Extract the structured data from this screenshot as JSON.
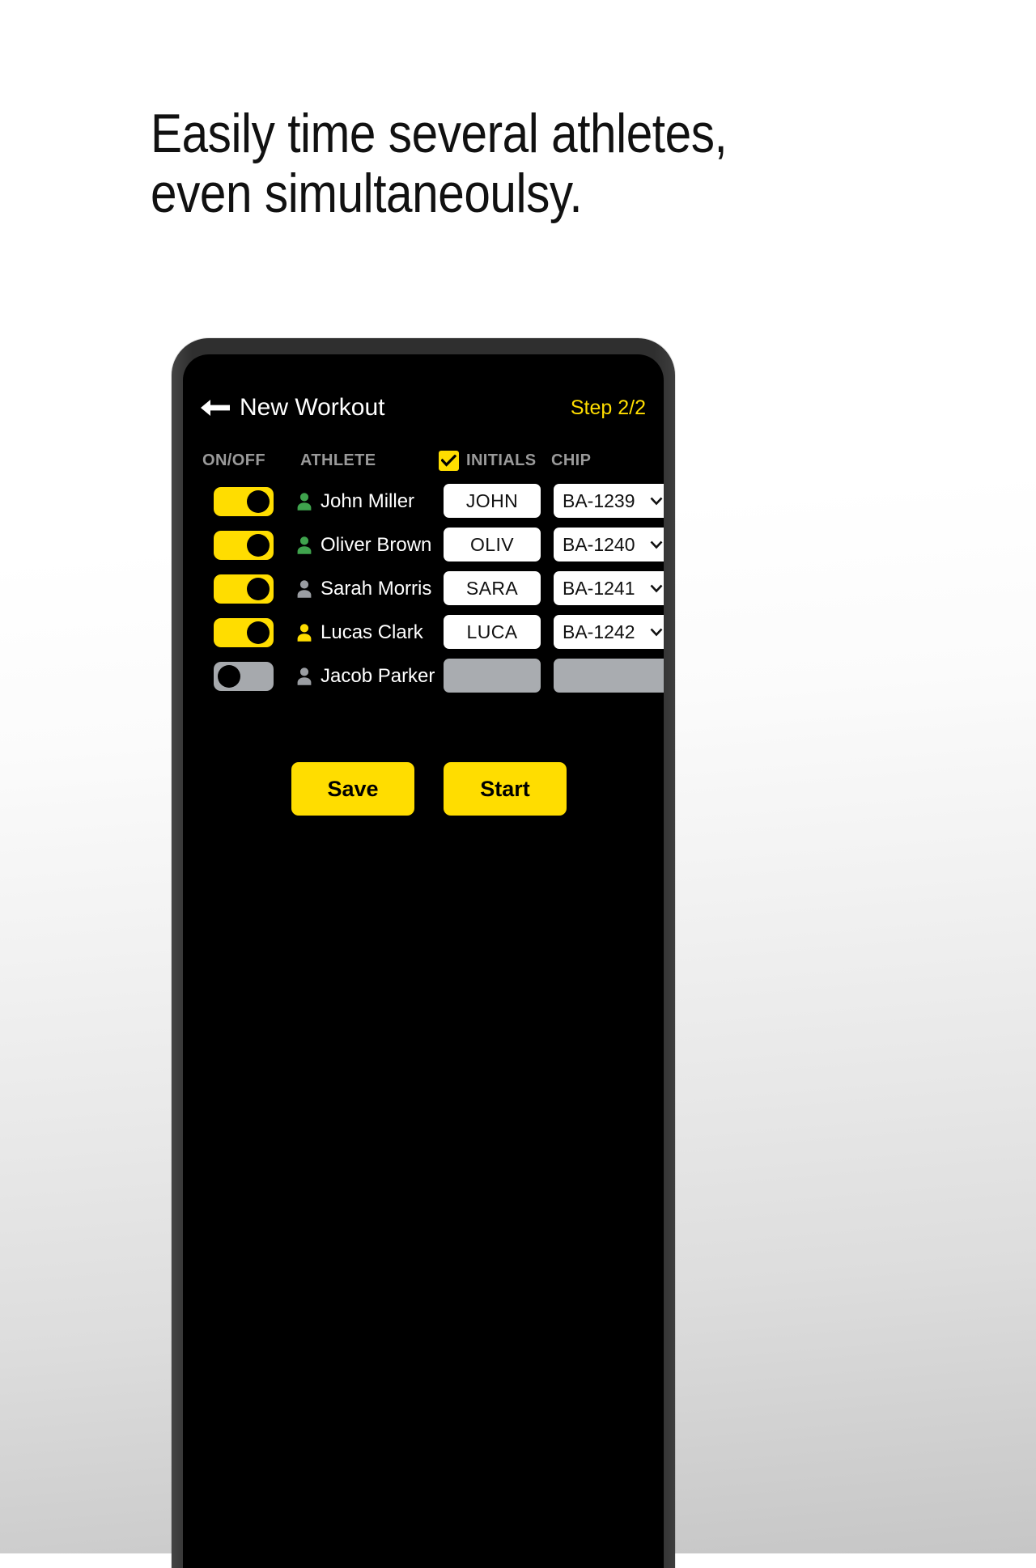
{
  "headline": {
    "line1": "Easily time several athletes,",
    "line2": "even simultaneoulsy."
  },
  "colors": {
    "accent": "#FFDD00",
    "screen_bg": "#000000",
    "phone_bezel": "#2F2F2F",
    "header_label": "#9A9A9A",
    "disabled": "#A9ACB0",
    "icon_green": "#3FA34D",
    "icon_gray": "#9A9DA2",
    "icon_yellow": "#FFDD00"
  },
  "app": {
    "back_icon": "arrow-left-icon",
    "title": "New Workout",
    "step_label": "Step 2/2"
  },
  "table": {
    "headers": {
      "onoff": "ON/OFF",
      "athlete": "ATHLETE",
      "initials": "INITIALS",
      "chip": "CHIP",
      "initials_checkbox_checked": true
    },
    "rows": [
      {
        "enabled": true,
        "icon_color": "#3FA34D",
        "name": "John Miller",
        "initials": "JOHN",
        "chip": "BA-1239"
      },
      {
        "enabled": true,
        "icon_color": "#3FA34D",
        "name": "Oliver Brown",
        "initials": "OLIV",
        "chip": "BA-1240"
      },
      {
        "enabled": true,
        "icon_color": "#9A9DA2",
        "name": "Sarah Morris",
        "initials": "SARA",
        "chip": "BA-1241"
      },
      {
        "enabled": true,
        "icon_color": "#FFDD00",
        "name": "Lucas Clark",
        "initials": "LUCA",
        "chip": "BA-1242"
      },
      {
        "enabled": false,
        "icon_color": "#9A9DA2",
        "name": "Jacob Parker",
        "initials": "",
        "chip": ""
      }
    ]
  },
  "actions": {
    "save_label": "Save",
    "start_label": "Start"
  }
}
